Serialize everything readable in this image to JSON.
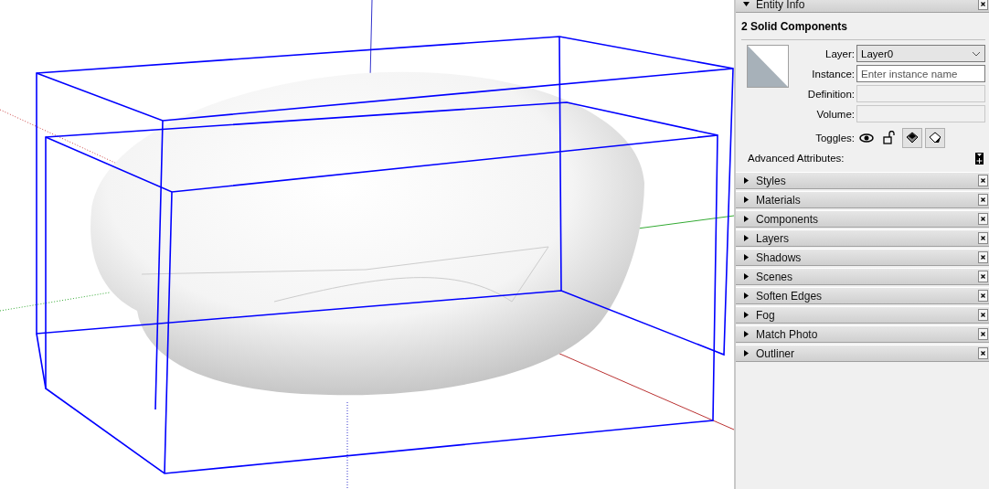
{
  "entity_info": {
    "title": "Entity Info",
    "expanded": true,
    "heading": "2 Solid Components",
    "fields": [
      {
        "kind": "dropdown",
        "label": "Layer:",
        "value": "Layer0",
        "disabled": false
      },
      {
        "kind": "text",
        "label": "Instance:",
        "placeholder": "Enter instance name",
        "disabled": false
      },
      {
        "kind": "text",
        "label": "Definition:",
        "disabled": true
      },
      {
        "kind": "text",
        "label": "Volume:",
        "disabled": true
      }
    ],
    "toggles_label": "Toggles:",
    "toggles": [
      {
        "kind": "hidden",
        "on": false
      },
      {
        "kind": "locked",
        "on": false
      },
      {
        "kind": "cast-shadows",
        "on": true
      },
      {
        "kind": "receive-shadows",
        "on": true
      }
    ],
    "advanced_label": "Advanced Attributes:"
  },
  "trays": [
    {
      "title": "Styles",
      "expanded": false
    },
    {
      "title": "Materials",
      "expanded": false
    },
    {
      "title": "Components",
      "expanded": false
    },
    {
      "title": "Layers",
      "expanded": false
    },
    {
      "title": "Shadows",
      "expanded": false
    },
    {
      "title": "Scenes",
      "expanded": false
    },
    {
      "title": "Soften Edges",
      "expanded": false
    },
    {
      "title": "Fog",
      "expanded": false
    },
    {
      "title": "Match Photo",
      "expanded": false
    },
    {
      "title": "Outliner",
      "expanded": false
    }
  ]
}
